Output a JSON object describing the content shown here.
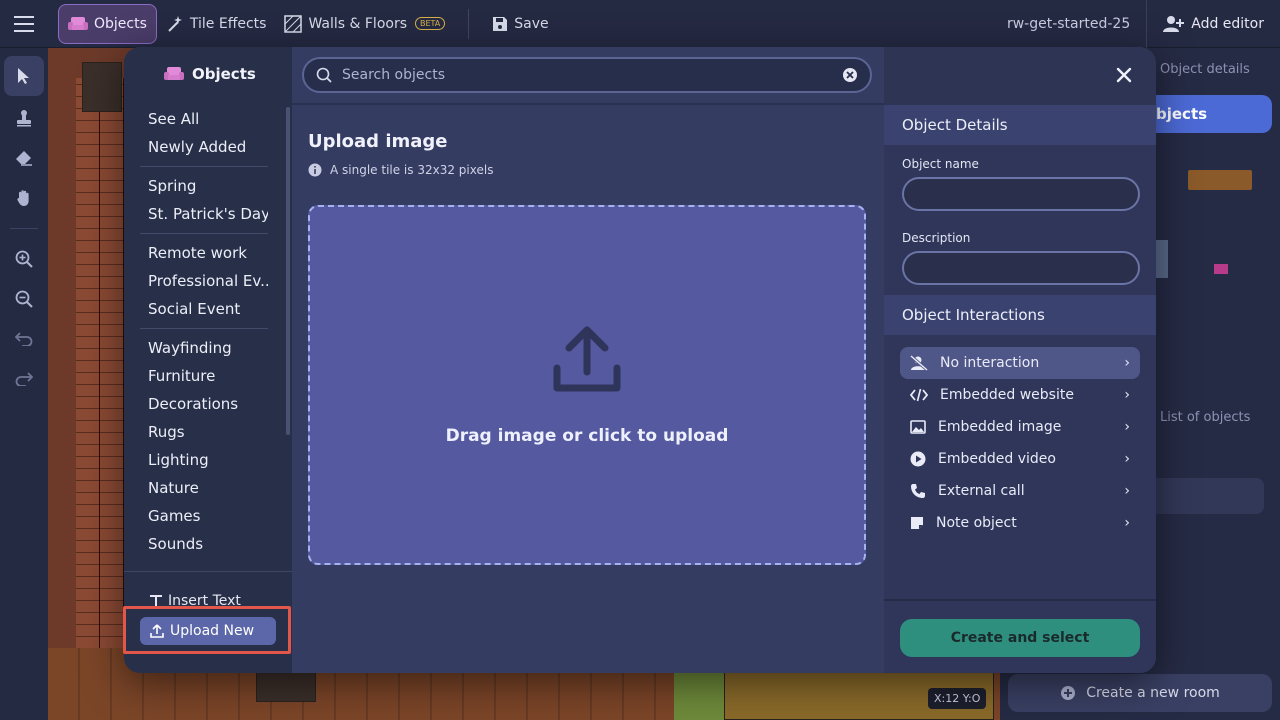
{
  "topbar": {
    "objects_label": "Objects",
    "tile_effects_label": "Tile Effects",
    "walls_floors_label": "Walls & Floors",
    "beta_badge": "BETA",
    "save_label": "Save",
    "room_name": "rw-get-started-25",
    "add_editor_label": "Add editor"
  },
  "right_panel": {
    "tab_label": "Object details",
    "objects_button": "bjects",
    "list_label": "List of objects",
    "create_room_label": "Create a new room",
    "coords": "X:12  Y:O"
  },
  "modal": {
    "title": "Objects",
    "categories_group1": [
      "See All",
      "Newly Added"
    ],
    "categories_group2": [
      "Spring",
      "St. Patrick's Day"
    ],
    "categories_group3": [
      "Remote work",
      "Professional Ev...",
      "Social Event"
    ],
    "categories_group4": [
      "Wayfinding",
      "Furniture",
      "Decorations",
      "Rugs",
      "Lighting",
      "Nature",
      "Games",
      "Sounds"
    ],
    "insert_text_label": "Insert Text",
    "upload_new_label": "Upload New",
    "search_placeholder": "Search objects",
    "upload_title": "Upload image",
    "upload_note": "A single tile is 32x32 pixels",
    "dropzone_text": "Drag image or click to upload",
    "details_header": "Object Details",
    "object_name_label": "Object name",
    "description_label": "Description",
    "interactions_header": "Object Interactions",
    "interactions": [
      {
        "label": "No interaction",
        "icon": "person-off-icon"
      },
      {
        "label": "Embedded website",
        "icon": "code-icon"
      },
      {
        "label": "Embedded image",
        "icon": "image-icon"
      },
      {
        "label": "Embedded video",
        "icon": "play-icon"
      },
      {
        "label": "External call",
        "icon": "phone-icon"
      },
      {
        "label": "Note object",
        "icon": "note-icon"
      }
    ],
    "create_button": "Create and select"
  },
  "colors": {
    "highlight": "#e3574a",
    "accent": "#4c6ad6",
    "create_button": "#2f8f7f"
  }
}
